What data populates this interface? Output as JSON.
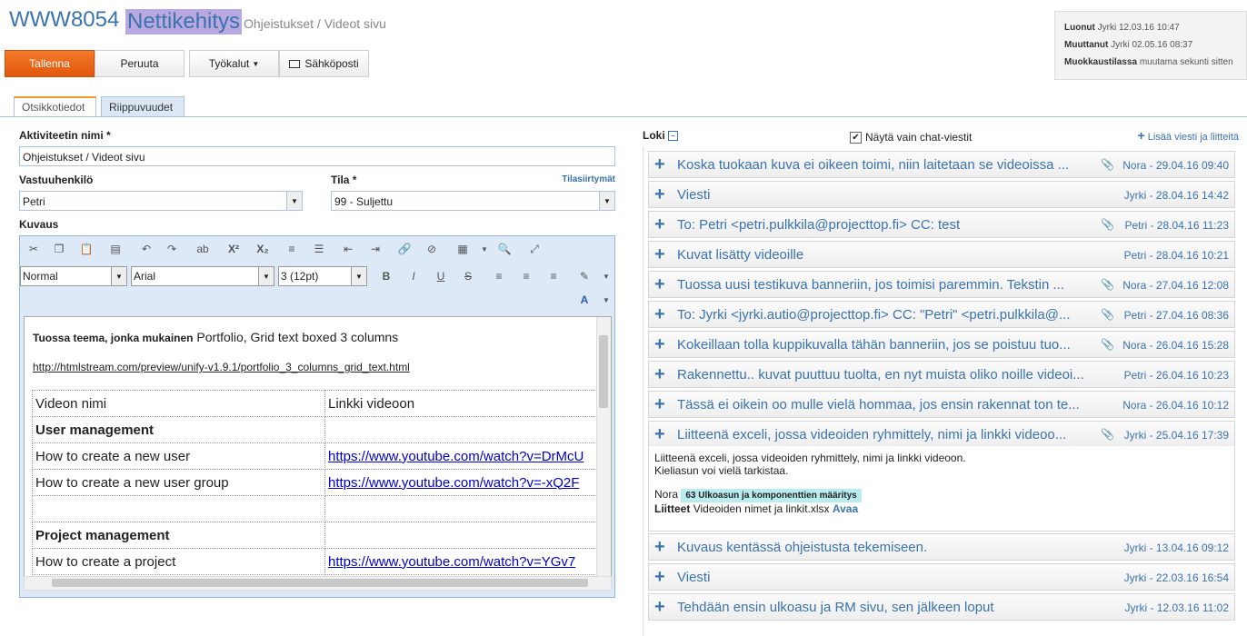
{
  "header": {
    "code": "WWW8054",
    "name": "Nettikehitys",
    "subtitle": "Ohjeistukset / Videot sivu"
  },
  "meta": {
    "created_label": "Luonut",
    "created_value": "Jyrki 12.03.16 10:47",
    "modified_label": "Muuttanut",
    "modified_value": "Jyrki 02.05.16 08:37",
    "editing_label": "Muokkaustilassa",
    "editing_value": "muutama sekunti sitten"
  },
  "toolbar": {
    "save": "Tallenna",
    "cancel": "Peruuta",
    "tools": "Työkalut",
    "email": "Sähköposti"
  },
  "tabs": [
    {
      "label": "Otsikkotiedot",
      "active": true
    },
    {
      "label": "Riippuvuudet",
      "active": false
    }
  ],
  "form": {
    "activity_label": "Aktiviteetin nimi *",
    "activity_value": "Ohjeistukset / Videot sivu",
    "owner_label": "Vastuuhenkilö",
    "owner_value": "Petri",
    "status_label": "Tila *",
    "status_value": "99 - Suljettu",
    "status_link": "Tilasiirtymät",
    "desc_label": "Kuvaus"
  },
  "editor": {
    "format": "Normal",
    "font": "Arial",
    "size": "3 (12pt)",
    "intro_bold": "Tuossa teema, jonka mukainen",
    "intro_rest": "Portfolio, Grid text boxed 3 columns",
    "intro_link": "http://htmlstream.com/preview/unify-v1.9.1/portfolio_3_columns_grid_text.html",
    "table": [
      {
        "c1": "Videon nimi",
        "c2": "Linkki videoon",
        "bold": false,
        "link": false
      },
      {
        "c1": "User management",
        "c2": "",
        "bold": true,
        "link": false
      },
      {
        "c1": "How to create a new user",
        "c2": "https://www.youtube.com/watch?v=DrMcU",
        "bold": false,
        "link": true
      },
      {
        "c1": "How to create a new user group",
        "c2": "https://www.youtube.com/watch?v=-xQ2F",
        "bold": false,
        "link": true
      },
      {
        "c1": "",
        "c2": "",
        "bold": false,
        "link": false
      },
      {
        "c1": "Project management",
        "c2": "",
        "bold": true,
        "link": false
      },
      {
        "c1": "How to create a project",
        "c2": "https://www.youtube.com/watch?v=YGv7",
        "bold": false,
        "link": true
      }
    ]
  },
  "log": {
    "title": "Loki",
    "chat_only_label": "Näytä vain chat-viestit",
    "chat_only_checked": true,
    "add_label": "Lisää viesti ja liitteitä",
    "items": [
      {
        "title": "Koska tuokaan kuva ei oikeen toimi, niin laitetaan se videoissa ...",
        "who": "Nora - 29.04.16 09:40",
        "attach": true
      },
      {
        "title": "Viesti",
        "who": "Jyrki - 28.04.16 14:42",
        "attach": false
      },
      {
        "title": "To: Petri <petri.pulkkila@projecttop.fi> CC: test",
        "who": "Petri - 28.04.16 11:23",
        "attach": true
      },
      {
        "title": "Kuvat lisätty videoille",
        "who": "Petri - 28.04.16 10:21",
        "attach": false
      },
      {
        "title": "Tuossa uusi testikuva banneriin, jos toimisi paremmin. Tekstin ...",
        "who": "Nora - 27.04.16 12:08",
        "attach": true
      },
      {
        "title": "To: Jyrki <jyrki.autio@projecttop.fi> CC: \"Petri\" <petri.pulkkila@...",
        "who": "Petri - 27.04.16 08:36",
        "attach": true
      },
      {
        "title": "Kokeillaan tolla kuppikuvalla tähän banneriin, jos se poistuu tuo...",
        "who": "Nora - 26.04.16 15:28",
        "attach": true
      },
      {
        "title": "Rakennettu.. kuvat puuttuu tuolta, en nyt muista oliko noille videoi...",
        "who": "Petri - 26.04.16 10:23",
        "attach": false
      },
      {
        "title": "Tässä ei oikein oo mulle vielä hommaa, jos ensin rakennat ton te...",
        "who": "Nora - 26.04.16 10:12",
        "attach": false
      },
      {
        "title": "Liitteenä exceli, jossa videoiden ryhmittely, nimi ja linkki videoo...",
        "who": "Jyrki - 25.04.16 17:39",
        "attach": true
      },
      {
        "title": "Kuvaus kentässä ohjeistusta tekemiseen.",
        "who": "Jyrki - 13.04.16 09:12",
        "attach": false
      },
      {
        "title": "Viesti",
        "who": "Jyrki - 22.03.16 16:54",
        "attach": false
      },
      {
        "title": "Tehdään ensin ulkoasu ja RM sivu, sen jälkeen loput",
        "who": "Jyrki - 12.03.16 11:02",
        "attach": false
      }
    ],
    "expanded": {
      "line1": "Liitteenä exceli, jossa videoiden ryhmittely, nimi ja linkki videoon.",
      "line2": "Kieliasun voi vielä tarkistaa.",
      "author": "Nora",
      "tag": "63 Ulkoasun ja komponenttien määritys",
      "attach_label": "Liitteet",
      "attach_file": "Videoiden nimet ja linkit.xlsx",
      "attach_open": "Avaa"
    }
  }
}
